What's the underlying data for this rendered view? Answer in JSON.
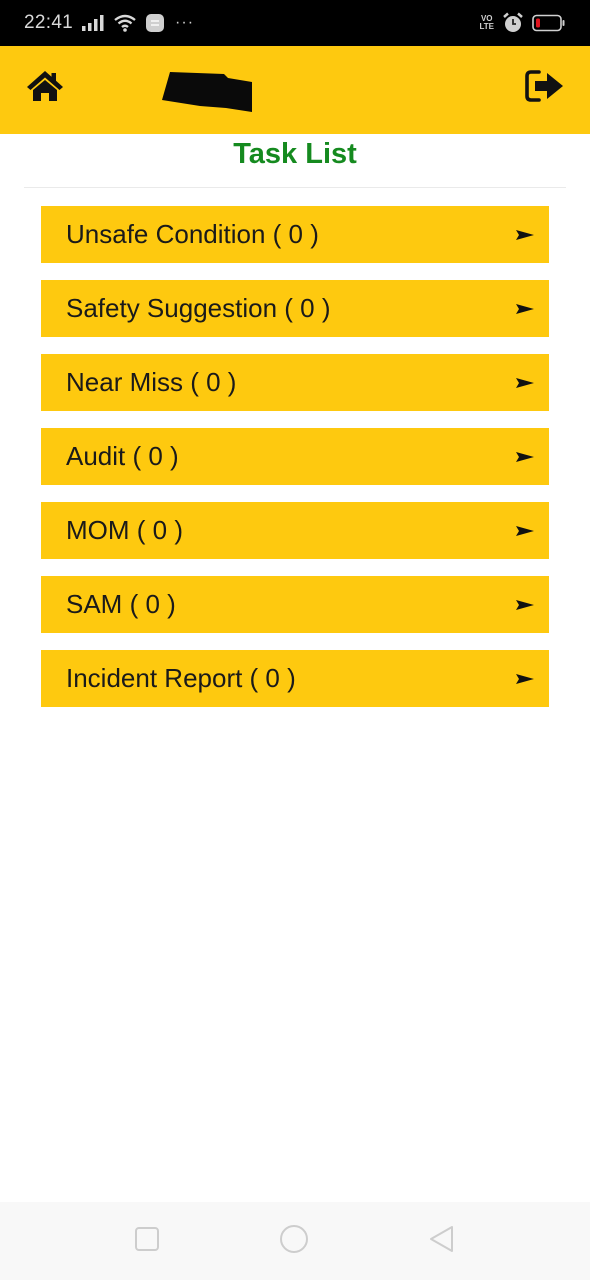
{
  "status_bar": {
    "time": "22:41",
    "overflow": "···",
    "network_label_top": "VO",
    "network_label_bottom": "LTE",
    "battery_color": "#e0141e"
  },
  "header": {
    "background": "#fec90f",
    "home_icon": "home-icon",
    "logout_icon": "sign-out-icon",
    "title_redacted": true
  },
  "page": {
    "title": "Task List",
    "title_color": "#158a1f"
  },
  "tasks": [
    {
      "label": "Unsafe Condition ( 0 )",
      "name": "Unsafe Condition",
      "count": 0,
      "arrow": "►"
    },
    {
      "label": "Safety Suggestion ( 0 )",
      "name": "Safety Suggestion",
      "count": 0,
      "arrow": "►"
    },
    {
      "label": "Near Miss ( 0 )",
      "name": "Near Miss",
      "count": 0,
      "arrow": "►"
    },
    {
      "label": "Audit ( 0 )",
      "name": "Audit",
      "count": 0,
      "arrow": "►"
    },
    {
      "label": "MOM ( 0 )",
      "name": "MOM",
      "count": 0,
      "arrow": "►"
    },
    {
      "label": "SAM ( 0 )",
      "name": "SAM",
      "count": 0,
      "arrow": "►"
    },
    {
      "label": "Incident Report ( 0 )",
      "name": "Incident Report",
      "count": 0,
      "arrow": "►"
    }
  ],
  "nav_bar": {
    "recents_icon": "square-icon",
    "home_icon": "circle-icon",
    "back_icon": "triangle-back-icon"
  }
}
